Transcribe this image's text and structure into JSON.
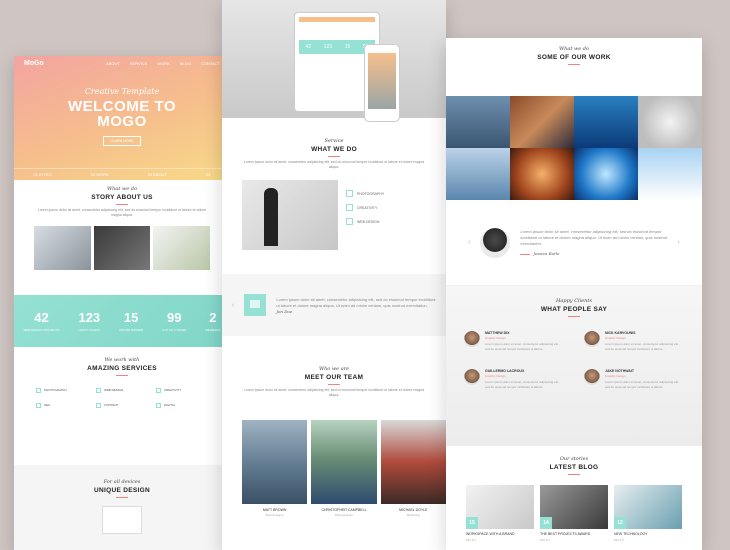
{
  "left": {
    "brand": "MoGo",
    "nav": [
      "ABOUT",
      "SERVICE",
      "WORK",
      "BLOG",
      "CONTACT"
    ],
    "hero_script": "Creative Template",
    "hero_title_1": "WELCOME TO",
    "hero_title_2": "MOGO",
    "hero_button": "LEARN MORE",
    "hero_stats": [
      "01 INTRO",
      "02 WORK",
      "03 ABOUT",
      "04"
    ],
    "story": {
      "script": "What we do",
      "title": "STORY ABOUT US",
      "text": "Lorem ipsum dolor sit amet, consectetur adipisicing elit, sed do eiusmod tempor incididunt ut labore et dolore magna aliqua."
    },
    "counters": [
      {
        "num": "42",
        "label": "WEB DESIGN PROJECTS"
      },
      {
        "num": "123",
        "label": "HAPPY CLIENT"
      },
      {
        "num": "15",
        "label": "AWARD WINNER"
      },
      {
        "num": "99",
        "label": "CUP OF COFFEE"
      },
      {
        "num": "2",
        "label": "MEMBERS"
      }
    ],
    "services": {
      "script": "We work with",
      "title": "AMAZING SERVICES",
      "items": [
        "PHOTOGRAPHY",
        "WEB DESIGN",
        "CREATIVITY",
        "SEO",
        "CONTENT",
        "DIGITAL"
      ]
    },
    "unique": {
      "script": "For all devices",
      "title": "UNIQUE DESIGN"
    }
  },
  "center": {
    "tablet_stats": [
      "42",
      "123",
      "15",
      "99"
    ],
    "whatwedo": {
      "script": "Service",
      "title": "WHAT WE DO",
      "text": "Lorem ipsum dolor sit amet, consectetur adipisicing elit, sed do eiusmod tempor incididunt ut labore et dolore magna aliqua.",
      "items": [
        "PHOTOGRAPHY",
        "CREATIVITY",
        "WEB DESIGN"
      ]
    },
    "quote": {
      "text": "Lorem ipsum dolor sit amet, consectetur adipisicing elit, sed do eiusmod tempor incididunt ut labore et dolore magna aliqua. Ut enim ad minim veniam, quis nostrud exercitation.",
      "author": "Jon Doe"
    },
    "team": {
      "script": "Who we are",
      "title": "MEET OUR TEAM",
      "text": "Lorem ipsum dolor sit amet, consectetur adipisicing elit, sed do eiusmod tempor incididunt ut labore et dolore magna aliqua.",
      "members": [
        {
          "name": "MATT BROWN",
          "role": "Web designer"
        },
        {
          "name": "CHRISTOPHER CAMPBELL",
          "role": "Photographer"
        },
        {
          "name": "MICHAEL DOYLE",
          "role": "Marketing"
        }
      ]
    }
  },
  "right": {
    "work": {
      "script": "What we do",
      "title": "SOME OF OUR WORK"
    },
    "quote": {
      "text": "Lorem ipsum dolor sit amet, consectetur adipisicing elit, sed do eiusmod tempor incididunt ut labore et dolore magna aliqua. Ut enim ad minim veniam, quis nostrud exercitation.",
      "author": "Jessica Earle"
    },
    "clients": {
      "script": "Happy Clients",
      "title": "WHAT PEOPLE SAY",
      "items": [
        {
          "name": "MATTHEW DIX",
          "role": "Graphic Design",
          "text": "Lorem ipsum dolor sit amet, consectetur adipisicing elit, sed do eiusmod tempor incididunt ut labore."
        },
        {
          "name": "NICK KARVOUNIS",
          "role": "Graphic Design",
          "text": "Lorem ipsum dolor sit amet, consectetur adipisicing elit, sed do eiusmod tempor incididunt ut labore."
        },
        {
          "name": "GUILLERMO LACROUX",
          "role": "Graphic Design",
          "text": "Lorem ipsum dolor sit amet, consectetur adipisicing elit, sed do eiusmod tempor incididunt ut labore."
        },
        {
          "name": "JAKE NOTHWAIT",
          "role": "Graphic Design",
          "text": "Lorem ipsum dolor sit amet, consectetur adipisicing elit, sed do eiusmod tempor incididunt ut labore."
        }
      ]
    },
    "blog": {
      "script": "Our stories",
      "title": "LATEST BLOG",
      "posts": [
        {
          "day": "15",
          "title": "WORKSPACE WITH A BRAND",
          "meta": "542   1/7"
        },
        {
          "day": "14",
          "title": "THE BEST PROJECTS AWARD",
          "meta": "542   1/7"
        },
        {
          "day": "12",
          "title": "NEW TECHNOLOGY",
          "meta": "542   1/7"
        }
      ]
    }
  }
}
